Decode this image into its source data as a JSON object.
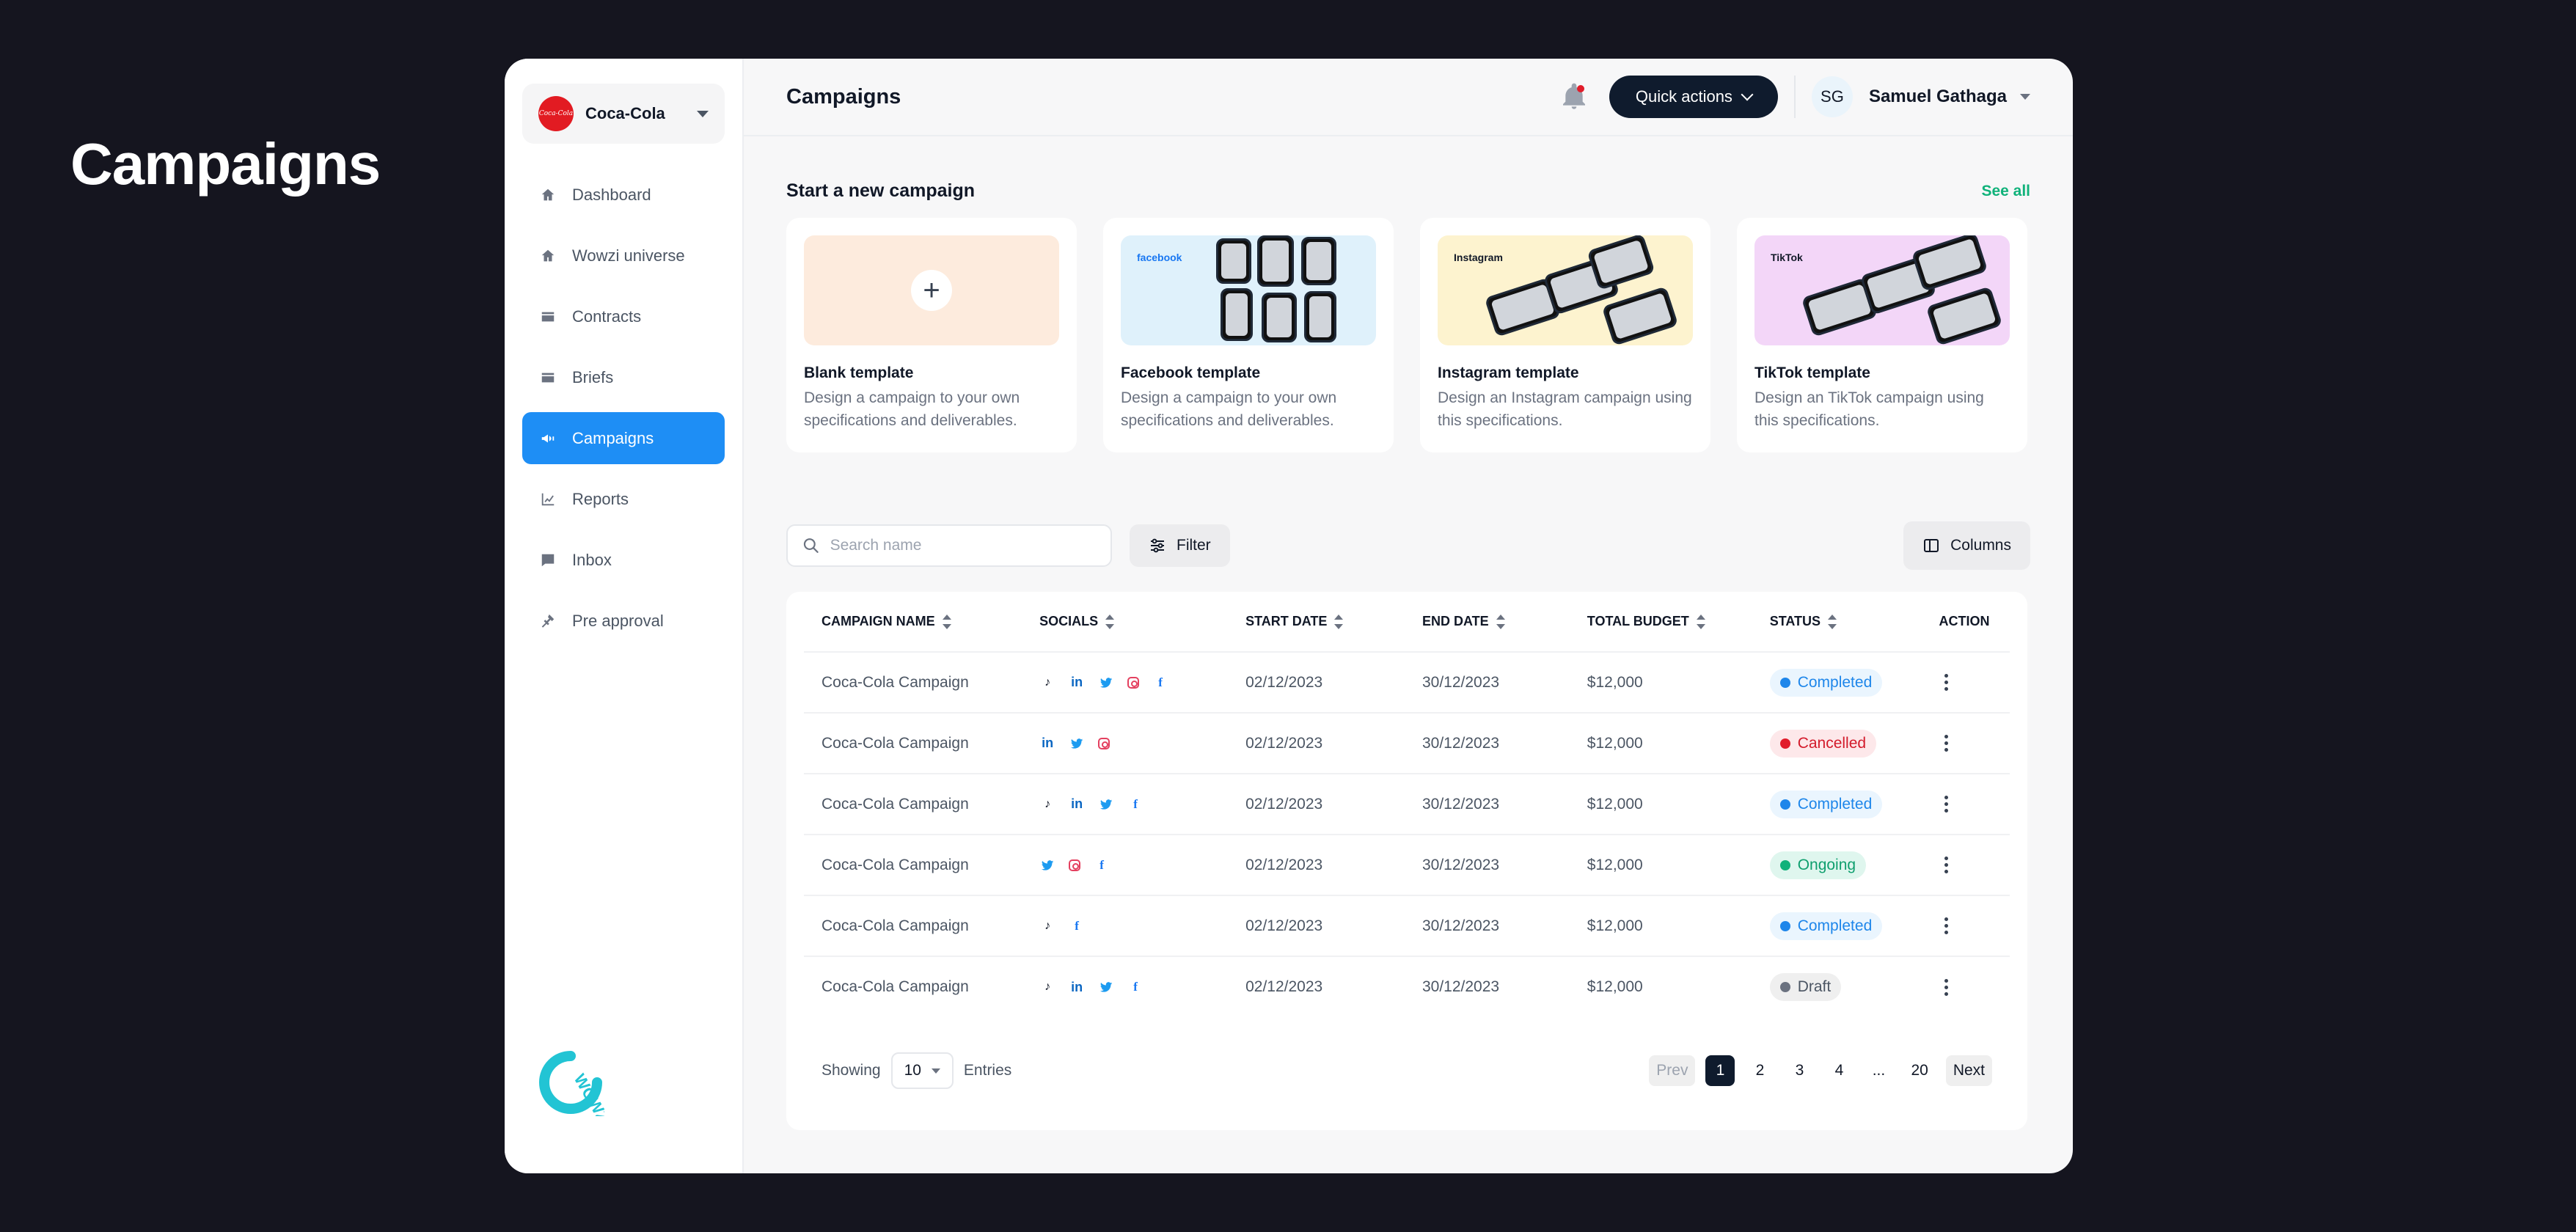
{
  "hero": {
    "title": "Campaigns"
  },
  "sidebar": {
    "brand": {
      "name": "Coca-Cola",
      "logo_text": "Coca-Cola"
    },
    "items": [
      {
        "label": "Dashboard",
        "icon": "home-icon"
      },
      {
        "label": "Wowzi universe",
        "icon": "home-icon"
      },
      {
        "label": "Contracts",
        "icon": "card-icon"
      },
      {
        "label": "Briefs",
        "icon": "card-icon"
      },
      {
        "label": "Campaigns",
        "icon": "megaphone-icon",
        "active": true
      },
      {
        "label": "Reports",
        "icon": "chart-icon"
      },
      {
        "label": "Inbox",
        "icon": "message-icon"
      },
      {
        "label": "Pre approval",
        "icon": "gavel-icon"
      }
    ],
    "footer_logo": "WOWZI"
  },
  "header": {
    "title": "Campaigns",
    "quick_actions": "Quick actions",
    "user": {
      "initials": "SG",
      "name": "Samuel Gathaga"
    }
  },
  "templates": {
    "title": "Start a new campaign",
    "see_all": "See all",
    "cards": [
      {
        "title": "Blank template",
        "desc": "Design a campaign to your own specifications and deliverables.",
        "bg": "#fdebdd"
      },
      {
        "title": "Facebook template",
        "desc": "Design a campaign to your own specifications and deliverables.",
        "bg": "#dff1fb",
        "tag": "facebook"
      },
      {
        "title": "Instagram template",
        "desc": "Design an Instagram campaign using this specifications.",
        "bg": "#fdf3cf",
        "tag": "Instagram"
      },
      {
        "title": "TikTok template",
        "desc": "Design an TikTok campaign using this specifications.",
        "bg": "#f3d6f8",
        "tag": "TikTok"
      }
    ]
  },
  "toolbar": {
    "search_placeholder": "Search name",
    "filter": "Filter",
    "columns": "Columns"
  },
  "table": {
    "headers": [
      "CAMPAIGN NAME",
      "SOCIALS",
      "START DATE",
      "END DATE",
      "TOTAL BUDGET",
      "STATUS",
      "ACTION"
    ],
    "rows": [
      {
        "name": "Coca-Cola Campaign",
        "socials": [
          "tiktok",
          "linkedin",
          "twitter",
          "instagram",
          "facebook"
        ],
        "start": "02/12/2023",
        "end": "30/12/2023",
        "budget": "$12,000",
        "status": "Completed",
        "status_key": "completed"
      },
      {
        "name": "Coca-Cola Campaign",
        "socials": [
          "linkedin",
          "twitter",
          "instagram"
        ],
        "start": "02/12/2023",
        "end": "30/12/2023",
        "budget": "$12,000",
        "status": "Cancelled",
        "status_key": "cancelled"
      },
      {
        "name": "Coca-Cola Campaign",
        "socials": [
          "tiktok",
          "linkedin",
          "twitter",
          "facebook"
        ],
        "start": "02/12/2023",
        "end": "30/12/2023",
        "budget": "$12,000",
        "status": "Completed",
        "status_key": "completed"
      },
      {
        "name": "Coca-Cola Campaign",
        "socials": [
          "twitter",
          "instagram",
          "facebook"
        ],
        "start": "02/12/2023",
        "end": "30/12/2023",
        "budget": "$12,000",
        "status": "Ongoing",
        "status_key": "ongoing"
      },
      {
        "name": "Coca-Cola Campaign",
        "socials": [
          "tiktok",
          "facebook"
        ],
        "start": "02/12/2023",
        "end": "30/12/2023",
        "budget": "$12,000",
        "status": "Completed",
        "status_key": "completed"
      },
      {
        "name": "Coca-Cola Campaign",
        "socials": [
          "tiktok",
          "linkedin",
          "twitter",
          "facebook"
        ],
        "start": "02/12/2023",
        "end": "30/12/2023",
        "budget": "$12,000",
        "status": "Draft",
        "status_key": "draft"
      }
    ]
  },
  "footer": {
    "showing": "Showing",
    "page_size": "10",
    "entries": "Entries",
    "prev": "Prev",
    "next": "Next",
    "pages": [
      "1",
      "2",
      "3",
      "4",
      "...",
      "20"
    ],
    "current_page": "1"
  },
  "colors": {
    "accent": "#1e8ef5",
    "dark": "#0f1b2d",
    "green": "#10b27a"
  }
}
